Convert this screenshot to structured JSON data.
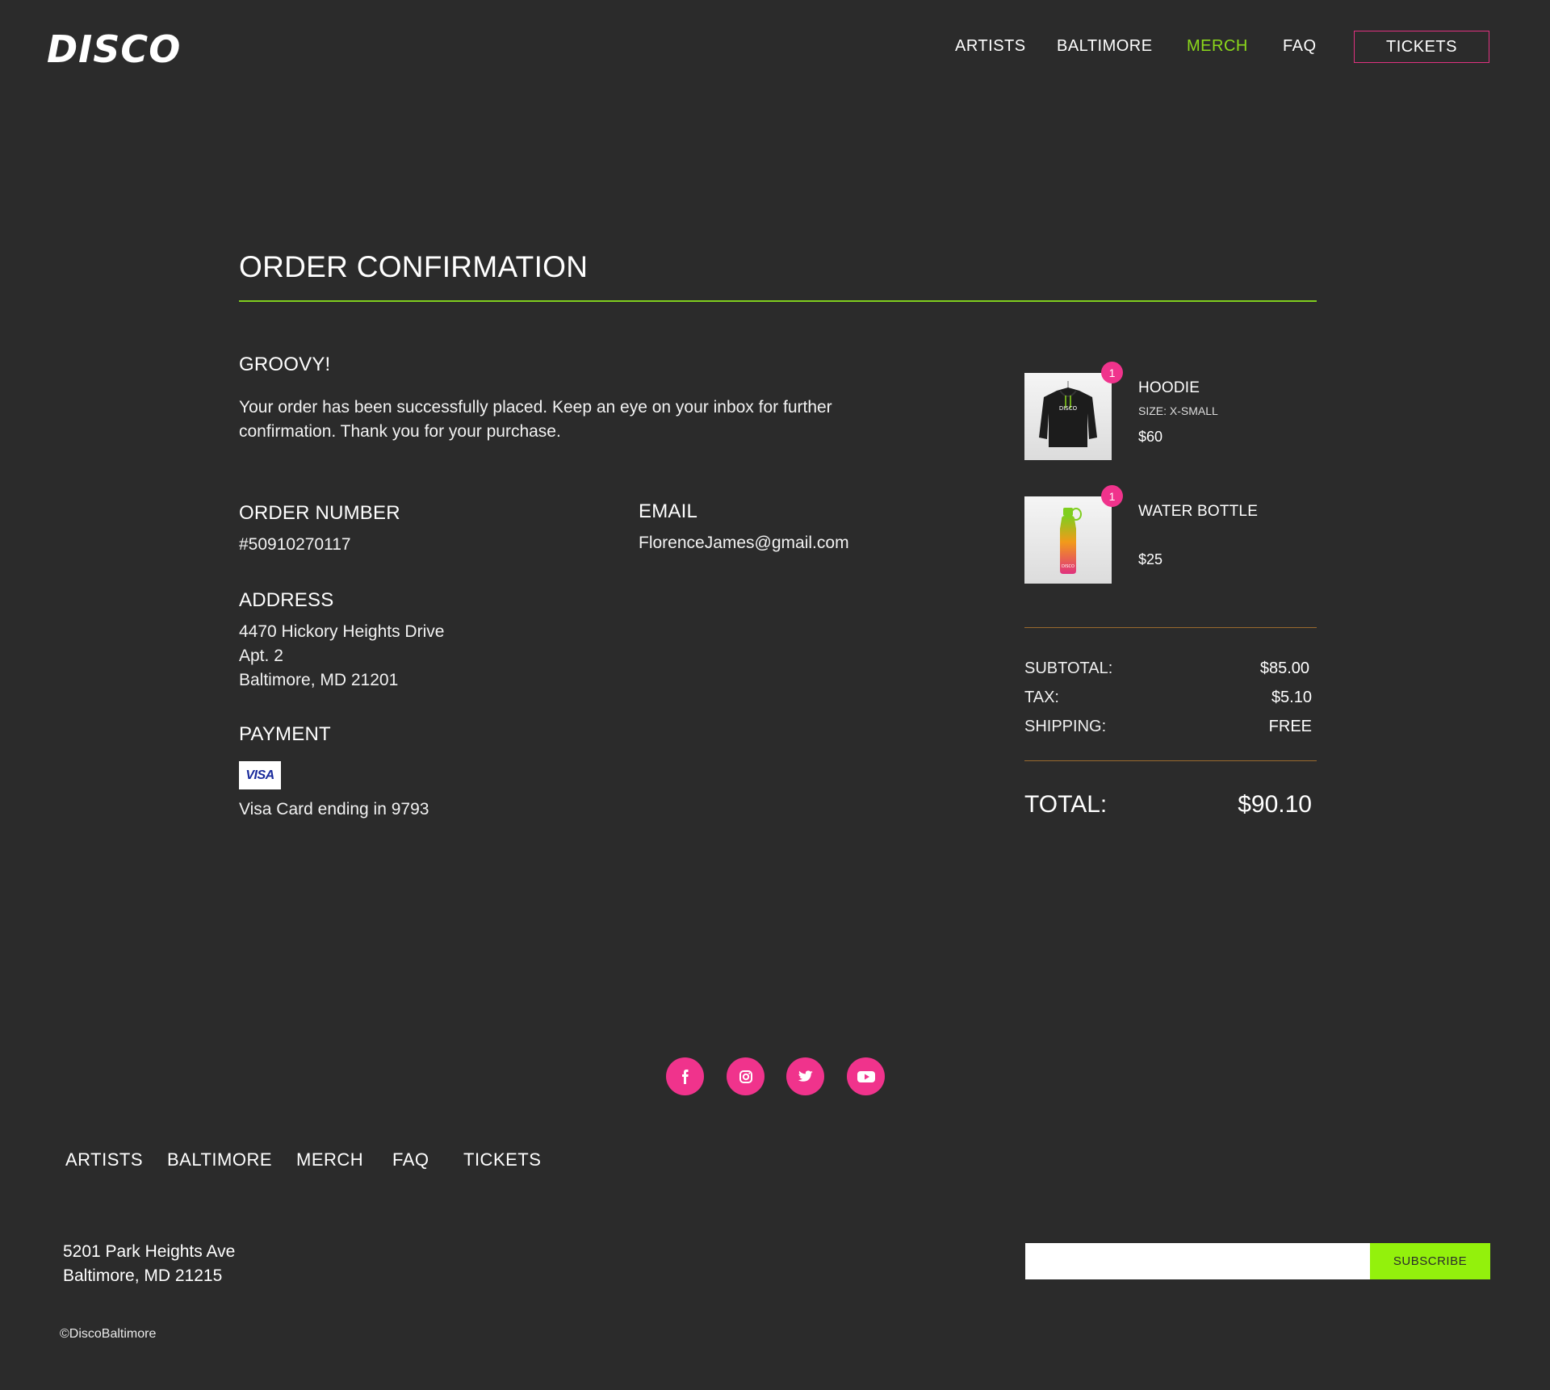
{
  "brand": {
    "logo": "DISCO"
  },
  "nav": {
    "items": [
      {
        "label": "ARTISTS"
      },
      {
        "label": "BALTIMORE"
      },
      {
        "label": "MERCH"
      },
      {
        "label": "FAQ"
      }
    ],
    "tickets_label": "TICKETS",
    "active_color": "#8cd91b"
  },
  "page": {
    "title": "ORDER CONFIRMATION",
    "greeting": "GROOVY!",
    "message": "Your order has been successfully placed. Keep an eye on your inbox for further confirmation. Thank you for your purchase."
  },
  "order": {
    "number_heading": "ORDER NUMBER",
    "number": "#50910270117",
    "email_heading": "EMAIL",
    "email": "FlorenceJames@gmail.com",
    "address_heading": "ADDRESS",
    "address_lines": [
      "4470 Hickory Heights Drive",
      "Apt. 2",
      "Baltimore, MD 21201"
    ],
    "payment_heading": "PAYMENT",
    "card_brand": "VISA",
    "card_text": "Visa Card ending in 9793"
  },
  "cart": {
    "items": [
      {
        "name": "HOODIE",
        "size": "SIZE: X-SMALL",
        "price": "$60",
        "qty": "1",
        "thumb_logo": "DISCO"
      },
      {
        "name": "WATER BOTTLE",
        "size": "",
        "price": "$25",
        "qty": "1",
        "thumb_logo": "DISCO"
      }
    ],
    "summary": {
      "subtotal_label": "SUBTOTAL:",
      "subtotal": "$85.00",
      "tax_label": "TAX:",
      "tax": "$5.10",
      "shipping_label": "SHIPPING:",
      "shipping": "FREE",
      "total_label": "TOTAL:",
      "total": "$90.10"
    }
  },
  "footer": {
    "social": [
      {
        "icon": "facebook-icon"
      },
      {
        "icon": "instagram-icon"
      },
      {
        "icon": "twitter-icon"
      },
      {
        "icon": "youtube-icon"
      }
    ],
    "nav": [
      "ARTISTS",
      "BALTIMORE",
      "MERCH",
      "FAQ",
      "TICKETS"
    ],
    "address_lines": [
      "5201 Park Heights Ave",
      "Baltimore, MD 21215"
    ],
    "email_placeholder": "",
    "subscribe_label": "SUBSCRIBE",
    "copyright": "©DiscoBaltimore"
  },
  "colors": {
    "background": "#2b2b2b",
    "accent_green": "#8cd91b",
    "accent_pink": "#f0338c",
    "subscribe_green": "#93f10c"
  }
}
